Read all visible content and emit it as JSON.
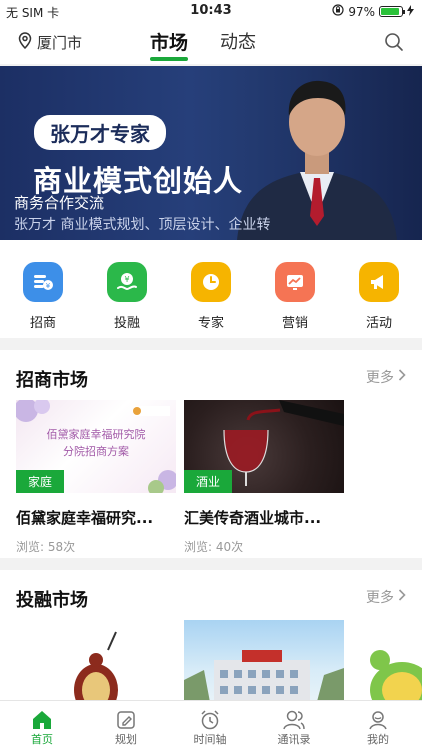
{
  "status_bar": {
    "carrier": "无 SIM 卡",
    "time": "10:43",
    "battery": "97%",
    "battery_level": 0.97
  },
  "top_nav": {
    "location": "厦门市",
    "tabs": [
      {
        "label": "市场"
      },
      {
        "label": "动态"
      }
    ]
  },
  "banner": {
    "pill": "张万才专家",
    "headline": "商业模式创始人",
    "subtitle": "商务合作交流",
    "description": "张万才 商业模式规划、顶层设计、企业转"
  },
  "categories": [
    {
      "label": "招商",
      "icon": "coin-stack-icon",
      "color": "#3d8fe8"
    },
    {
      "label": "投融",
      "icon": "hand-money-icon",
      "color": "#2bb84a"
    },
    {
      "label": "专家",
      "icon": "clock-icon",
      "color": "#f6b400"
    },
    {
      "label": "营销",
      "icon": "chart-icon",
      "color": "#f57454"
    },
    {
      "label": "活动",
      "icon": "megaphone-icon",
      "color": "#f6b400"
    }
  ],
  "zhaoshang": {
    "title": "招商市场",
    "more": "更多",
    "cards": [
      {
        "tag": "家庭",
        "thumb_text": "佰黛家庭幸福研究院\n分院招商方案",
        "name": "佰黛家庭幸福研究...",
        "views": "浏览: 58次"
      },
      {
        "tag": "酒业",
        "name": "汇美传奇酒业城市...",
        "views": "浏览: 40次"
      }
    ]
  },
  "tourong": {
    "title": "投融市场",
    "more": "更多"
  },
  "tabbar": [
    {
      "label": "首页"
    },
    {
      "label": "规划"
    },
    {
      "label": "时间轴"
    },
    {
      "label": "通讯录"
    },
    {
      "label": "我的"
    }
  ]
}
